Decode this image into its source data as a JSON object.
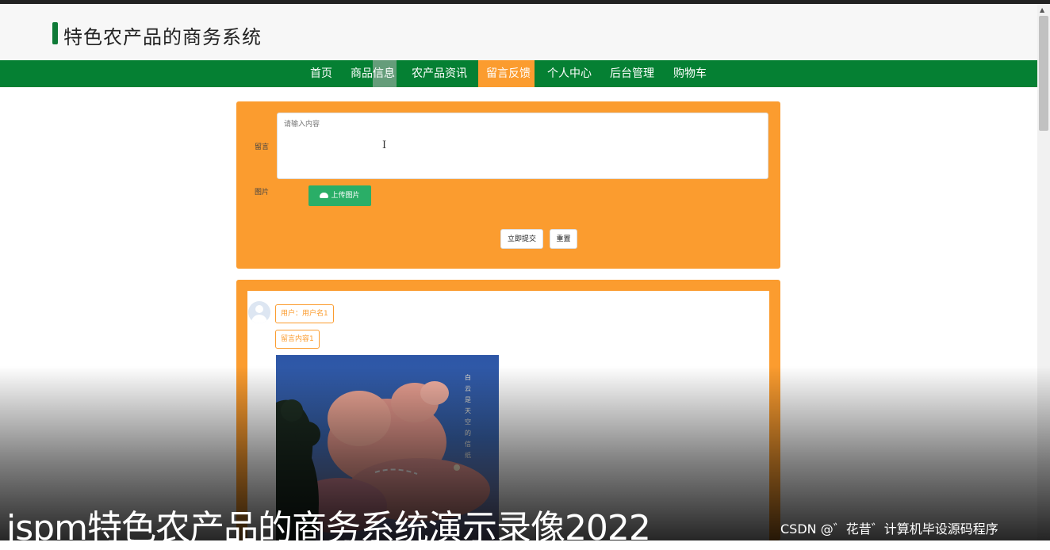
{
  "header": {
    "site_title": "特色农产品的商务系统"
  },
  "nav": {
    "items": [
      "首页",
      "商品信息",
      "农产品资讯",
      "留言反馈",
      "个人中心",
      "后台管理",
      "购物车"
    ],
    "active": "留言反馈"
  },
  "form": {
    "message_label": "留言",
    "message_placeholder": "请输入内容",
    "image_label": "图片",
    "upload_label": "上传图片",
    "submit_label": "立即提交",
    "reset_label": "重置"
  },
  "feedback": {
    "user_tag": "用户：用户名1",
    "content_tag": "留言内容1",
    "photo_text": "白云是天空的信纸"
  },
  "overlay": {
    "caption": "jspm特色农产品的商务系统演示录像2022",
    "watermark": "CSDN @゛花昔゛计算机毕设源码程序"
  },
  "colors": {
    "nav_green": "#058033",
    "accent_orange": "#fb9c2f",
    "upload_green": "#2aae67"
  },
  "icons": [
    "cloud-upload-icon",
    "user-avatar-icon",
    "text-cursor-icon"
  ]
}
